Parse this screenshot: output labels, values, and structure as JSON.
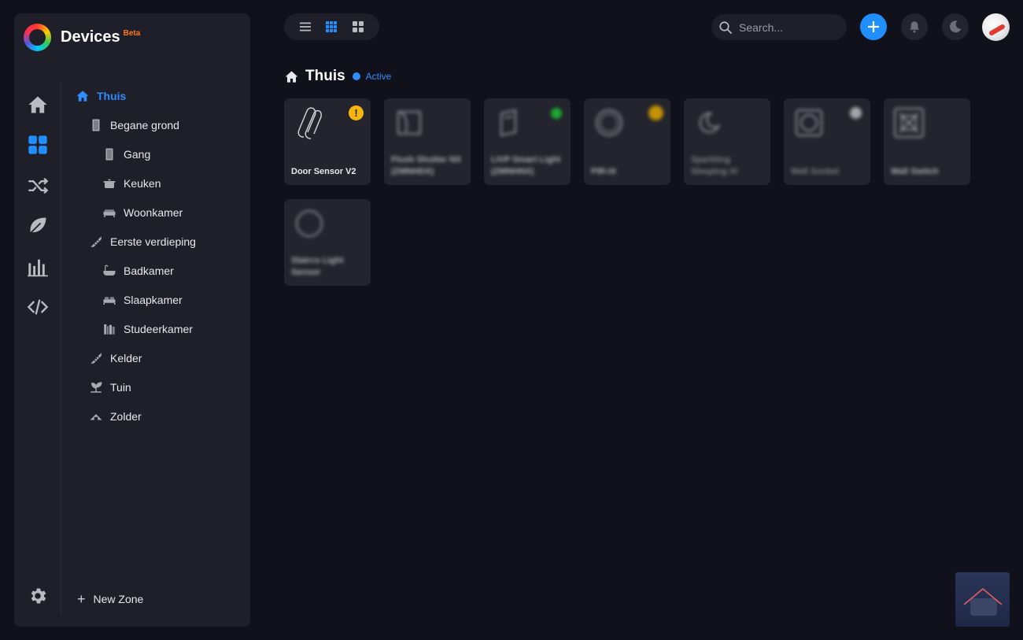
{
  "app": {
    "title": "Devices",
    "badge": "Beta"
  },
  "rail": {
    "items": [
      {
        "icon": "home-icon",
        "active": false
      },
      {
        "icon": "devices-icon",
        "active": true
      },
      {
        "icon": "flows-icon",
        "active": false
      },
      {
        "icon": "energy-leaf-icon",
        "active": false
      },
      {
        "icon": "insights-icon",
        "active": false
      },
      {
        "icon": "developer-code-icon",
        "active": false
      }
    ],
    "settings_icon": "gear-icon"
  },
  "zones": {
    "items": [
      {
        "label": "Thuis",
        "level": 0,
        "icon": "home-icon",
        "active": true
      },
      {
        "label": "Begane grond",
        "level": 1,
        "icon": "floor-icon"
      },
      {
        "label": "Gang",
        "level": 2,
        "icon": "door-icon"
      },
      {
        "label": "Keuken",
        "level": 2,
        "icon": "pot-icon"
      },
      {
        "label": "Woonkamer",
        "level": 2,
        "icon": "sofa-icon"
      },
      {
        "label": "Eerste verdieping",
        "level": 1,
        "icon": "stairs-icon"
      },
      {
        "label": "Badkamer",
        "level": 2,
        "icon": "bathtub-icon"
      },
      {
        "label": "Slaapkamer",
        "level": 2,
        "icon": "bed-icon"
      },
      {
        "label": "Studeerkamer",
        "level": 2,
        "icon": "bookshelf-icon"
      },
      {
        "label": "Kelder",
        "level": 1,
        "icon": "stairs-icon"
      },
      {
        "label": "Tuin",
        "level": 1,
        "icon": "plant-icon"
      },
      {
        "label": "Zolder",
        "level": 1,
        "icon": "attic-icon"
      }
    ],
    "new_zone_label": "New Zone"
  },
  "toolbar": {
    "view_modes": [
      "list-view-icon",
      "small-grid-view-icon",
      "large-grid-view-icon"
    ],
    "active_view": 1,
    "search_placeholder": "Search..."
  },
  "zone_header": {
    "title": "Thuis",
    "status": "Active"
  },
  "devices": [
    {
      "name": "Door Sensor V2",
      "icon": "paperclip-sensor-icon",
      "status": "warning",
      "status_color": "#f5b50a",
      "blurred": false
    },
    {
      "name": "Flush Shutter NX (ZMNHDX)",
      "icon": "shutter-icon",
      "status": "",
      "blurred": true
    },
    {
      "name": "LIVP Smart Light (ZMNHNX)",
      "icon": "light-module-icon",
      "status": "on",
      "status_color": "#1fbf35",
      "blurred": true
    },
    {
      "name": "PIR-IX",
      "icon": "motion-sensor-icon",
      "status": "alarm",
      "status_color": "#e0a500",
      "blurred": true
    },
    {
      "name": "Sparkling Sleeping XI",
      "icon": "moon-sensor-icon",
      "status": "",
      "blurred": true
    },
    {
      "name": "Wall Socket",
      "icon": "socket-icon",
      "status": "idle",
      "status_color": "#bdbdc2",
      "blurred": true
    },
    {
      "name": "Wall Switch",
      "icon": "switch-icon",
      "status": "",
      "blurred": true
    },
    {
      "name": "Staircs Light Sensor",
      "icon": "light-sensor-icon",
      "status": "",
      "blurred": true
    }
  ],
  "colors": {
    "accent": "#1f8fff",
    "background": "#10111a",
    "panel": "#1e1f28",
    "card": "#23242d"
  }
}
